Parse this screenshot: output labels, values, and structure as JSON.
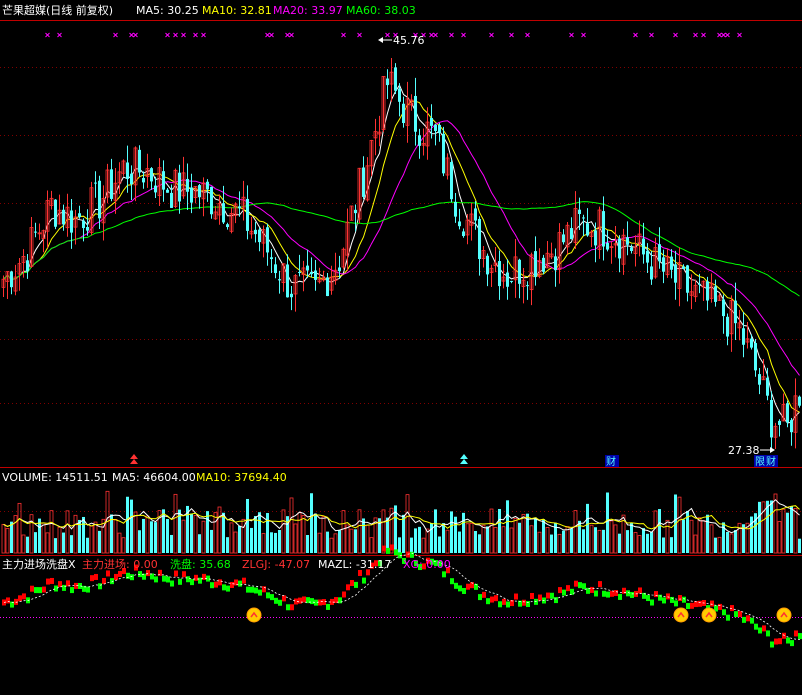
{
  "title_bar": {
    "stock": "芒果超媒(日线 前复权)",
    "ma5_label": "MA5: 30.25",
    "ma10_label": "MA10: 32.81",
    "ma20_label": "MA20: 33.97",
    "ma60_label": "MA60: 38.03"
  },
  "price_annotations": {
    "high_label": "45.76",
    "low_label": "27.38",
    "event_cai": "财",
    "event_cai_kanban": "财",
    "event_xian": "限"
  },
  "volume_bar": {
    "label": "VOLUME: 14511.51",
    "ma5_label": "MA5: 46604.00",
    "ma10_label": "MA10: 37694.40"
  },
  "indicator_bar": {
    "name": "主力进场洗盘X",
    "zljc_label": "主力进场: 0.00",
    "xp_label": "洗盘: 35.68",
    "zlgj_label": "ZLGJ: -47.07",
    "mazl_label": "MAZL: -31.17",
    "xg_label": "XG: 0.00"
  },
  "colors": {
    "background": "#000000",
    "up": "#ff3232",
    "down": "#54ffff",
    "ma5": "#ffffff",
    "ma10": "#ffff00",
    "ma20": "#ff00ff",
    "ma60": "#00ff00",
    "divider": "#c00000",
    "grid": "#800000",
    "xp_green": "#00ff00",
    "zl_red": "#ff0000"
  },
  "icons": {
    "marker_top": "cross-marker-icon",
    "signal": "yellow-up-signal-icon"
  },
  "chart_data": {
    "type": "candlestick",
    "price_range": [
      26.5,
      47.5
    ],
    "anchor_points": [
      [
        0,
        35.0
      ],
      [
        6,
        36.3
      ],
      [
        12,
        38.6
      ],
      [
        18,
        37.9
      ],
      [
        24,
        38.8
      ],
      [
        30,
        40.4
      ],
      [
        36,
        40.3
      ],
      [
        42,
        39.4
      ],
      [
        48,
        39.3
      ],
      [
        54,
        38.8
      ],
      [
        60,
        38.0
      ],
      [
        66,
        36.4
      ],
      [
        72,
        34.6
      ],
      [
        78,
        34.4
      ],
      [
        84,
        36.0
      ],
      [
        90,
        40.1
      ],
      [
        96,
        44.6
      ],
      [
        102,
        42.9
      ],
      [
        108,
        41.9
      ],
      [
        114,
        38.5
      ],
      [
        120,
        36.4
      ],
      [
        126,
        35.2
      ],
      [
        132,
        35.9
      ],
      [
        138,
        36.5
      ],
      [
        144,
        37.7
      ],
      [
        150,
        37.5
      ],
      [
        156,
        36.8
      ],
      [
        162,
        35.8
      ],
      [
        168,
        34.9
      ],
      [
        174,
        34.1
      ],
      [
        180,
        33.3
      ],
      [
        184,
        32.5
      ],
      [
        188,
        30.5
      ],
      [
        192,
        28.2
      ],
      [
        196,
        27.6
      ],
      [
        199,
        29.5
      ]
    ],
    "high_price": 45.76,
    "low_price": 27.38,
    "volume_range": [
      0,
      70000
    ],
    "volume_ma5": 46604.0,
    "volume_ma10": 37694.4,
    "last_volume": 14511.51,
    "indicator_range": [
      -55,
      10
    ],
    "indicator_values": {
      "zljc": 0.0,
      "xp": 35.68,
      "zlgj": -47.07,
      "mazl": -31.17,
      "xg": 0.0
    }
  }
}
